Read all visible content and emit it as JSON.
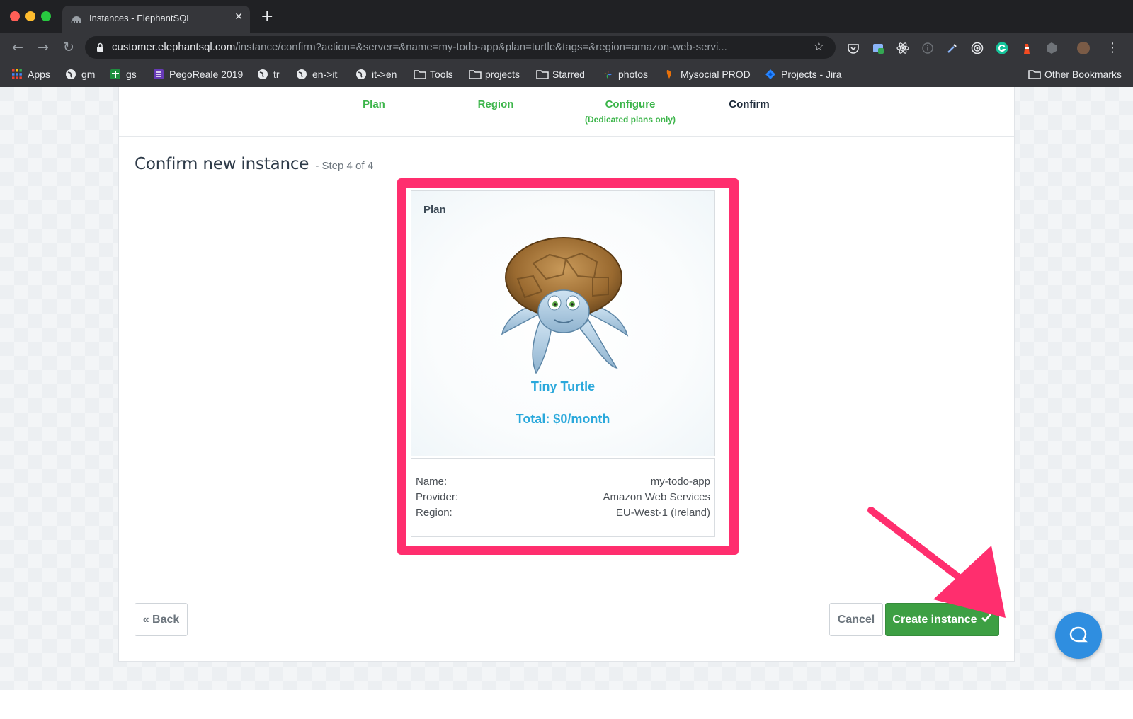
{
  "browser": {
    "tab_title": "Instances - ElephantSQL",
    "url_host": "customer.elephantsql.com",
    "url_path": "/instance/confirm?action=&server=&name=my-todo-app&plan=turtle&tags=&region=amazon-web-servi...",
    "bookmarks": [
      "Apps",
      "gm",
      "gs",
      "PegoReale 2019",
      "tr",
      "en->it",
      "it->en",
      "Tools",
      "projects",
      "Starred",
      "photos",
      "Mysocial PROD",
      "Projects - Jira"
    ],
    "other_bookmarks": "Other Bookmarks"
  },
  "steps": [
    {
      "label": "Plan",
      "sub": ""
    },
    {
      "label": "Region",
      "sub": ""
    },
    {
      "label": "Configure",
      "sub": "(Dedicated plans only)"
    },
    {
      "label": "Confirm",
      "sub": ""
    }
  ],
  "heading": {
    "title": "Confirm new instance",
    "subtitle": "- Step 4 of 4"
  },
  "plan": {
    "label": "Plan",
    "name": "Tiny Turtle",
    "total": "Total: $0/month"
  },
  "details": [
    {
      "key": "Name:",
      "value": "my-todo-app"
    },
    {
      "key": "Provider:",
      "value": "Amazon Web Services"
    },
    {
      "key": "Region:",
      "value": "EU-West-1 (Ireland)"
    }
  ],
  "footer": {
    "back_label": "« Back",
    "cancel_label": "Cancel",
    "create_label": "Create instance"
  },
  "colors": {
    "step_done": "#3cb54a",
    "highlight": "#ff2e6e",
    "plan_text": "#2aa8db",
    "create_button": "#3d9f43",
    "chat_button": "#2f8ee0"
  }
}
